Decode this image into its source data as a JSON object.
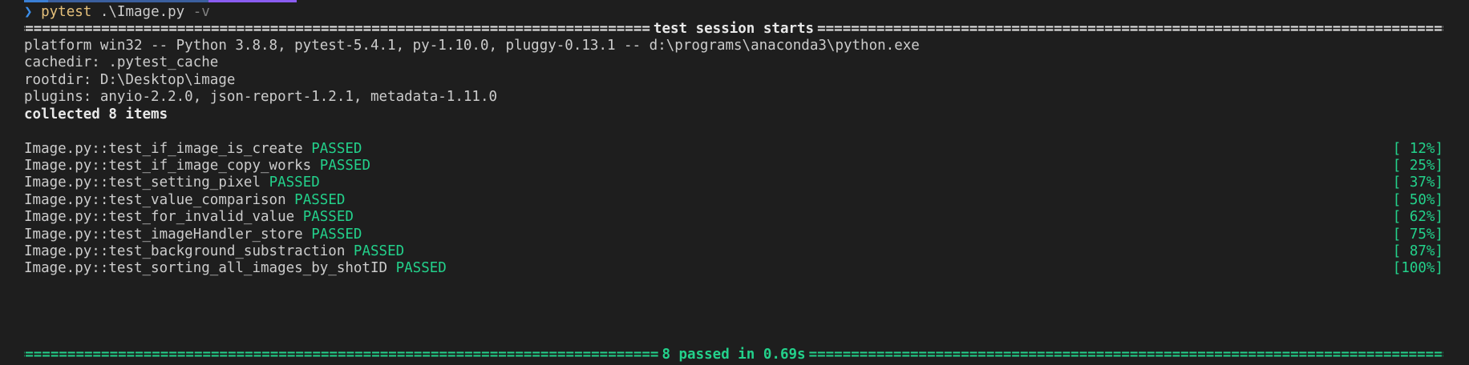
{
  "terminal": {
    "prompt": {
      "chevron": "❯",
      "command": "pytest",
      "args": ".\\Image.py",
      "flag": "-v"
    },
    "session_header": {
      "fill_char": "=",
      "label": "test session starts"
    },
    "info_lines": [
      "platform win32 -- Python 3.8.8, pytest-5.4.1, py-1.10.0, pluggy-0.13.1 -- d:\\programs\\anaconda3\\python.exe",
      "cachedir: .pytest_cache",
      "rootdir: D:\\Desktop\\image",
      "plugins: anyio-2.2.0, json-report-1.2.1, metadata-1.11.0"
    ],
    "collected": "collected 8 items",
    "tests": [
      {
        "name": "Image.py::test_if_image_is_create",
        "status": "PASSED",
        "progress": "[ 12%]"
      },
      {
        "name": "Image.py::test_if_image_copy_works",
        "status": "PASSED",
        "progress": "[ 25%]"
      },
      {
        "name": "Image.py::test_setting_pixel",
        "status": "PASSED",
        "progress": "[ 37%]"
      },
      {
        "name": "Image.py::test_value_comparison",
        "status": "PASSED",
        "progress": "[ 50%]"
      },
      {
        "name": "Image.py::test_for_invalid_value",
        "status": "PASSED",
        "progress": "[ 62%]"
      },
      {
        "name": "Image.py::test_imageHandler_store",
        "status": "PASSED",
        "progress": "[ 75%]"
      },
      {
        "name": "Image.py::test_background_substraction",
        "status": "PASSED",
        "progress": "[ 87%]"
      },
      {
        "name": "Image.py::test_sorting_all_images_by_shotID",
        "status": "PASSED",
        "progress": "[100%]"
      }
    ],
    "summary": {
      "fill_char": "=",
      "label": "8 passed in 0.69s"
    },
    "colors": {
      "background": "#1e1e1e",
      "text": "#cccccc",
      "passed": "#23d18b",
      "command": "#e5c07b",
      "prompt": "#3b8eea"
    }
  }
}
